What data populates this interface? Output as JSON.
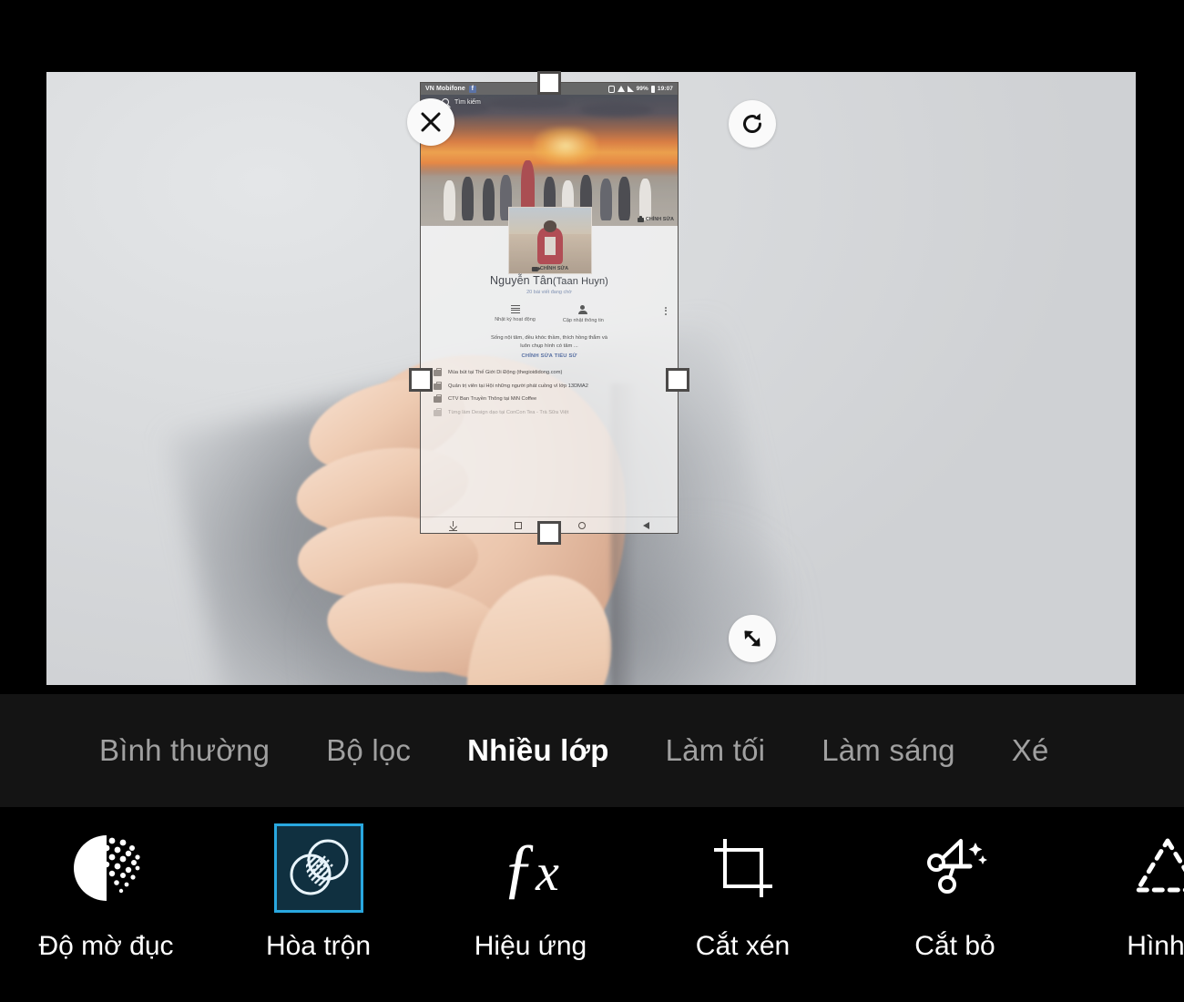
{
  "app": {
    "type": "photo-editor-mobile",
    "accent_selected": "#29a8e0",
    "tab_bar_bg": "#141414",
    "toolbar_bg": "#000000"
  },
  "canvas": {
    "background_photo_description": "hand holding phone against light gray wall with shadow",
    "controls": {
      "close": "close-icon",
      "rotate": "rotate-icon",
      "resize": "resize-diagonal-icon"
    }
  },
  "overlay_screenshot": {
    "status_bar": {
      "carrier": "VN Mobifone",
      "app_badge": "f",
      "battery": "99%",
      "time": "19:07"
    },
    "search": {
      "placeholder": "Tìm kiếm"
    },
    "cover": {
      "edit_label": "CHỈNH SỬA"
    },
    "avatar": {
      "edit_label": "CHỈNH SỬA"
    },
    "profile": {
      "name": "Nguyễn Tân",
      "nickname": "(Taan Huyn)",
      "subtitle": "20 bài viết đang chờ"
    },
    "actions": [
      {
        "icon": "activity-log-icon",
        "label": "Nhật ký hoạt động"
      },
      {
        "icon": "update-info-icon",
        "label": "Cập nhật thông tin"
      }
    ],
    "bio": {
      "line1": "Sống nội tâm, đều khóc thầm, thích hồng thắm và",
      "line2": "luôn chụp hình có tâm ...",
      "edit_label": "CHỈNH SỬA TIỂU SỬ"
    },
    "info_rows": [
      {
        "icon": "briefcase-icon",
        "text": "Múa bút tại Thế Giới Di Động (thegioididong.com)"
      },
      {
        "icon": "briefcase-icon",
        "text": "Quản trị viên tại Hội những người phát cuồng vì lớp 13DMA2"
      },
      {
        "icon": "briefcase-icon",
        "text": "CTV Ban Truyền Thông tại MiN Coffee"
      },
      {
        "icon": "briefcase-icon",
        "text": "Từng làm Design dạo tại ConCon Tea - Trà Sữa Việt"
      }
    ],
    "nav_bar": [
      "download-icon",
      "square-icon",
      "circle-icon",
      "back-triangle-icon"
    ]
  },
  "tabs": [
    {
      "label": "Bình thường",
      "active": false
    },
    {
      "label": "Bộ lọc",
      "active": false
    },
    {
      "label": "Nhiều lớp",
      "active": true
    },
    {
      "label": "Làm tối",
      "active": false
    },
    {
      "label": "Làm sáng",
      "active": false
    },
    {
      "label": "Xé",
      "active": false
    }
  ],
  "tools": [
    {
      "icon": "opacity-dots-icon",
      "label": "Độ mờ đục",
      "selected": false
    },
    {
      "icon": "blend-circles-icon",
      "label": "Hòa trộn",
      "selected": true
    },
    {
      "icon": "fx-icon",
      "label": "Hiệu ứng",
      "selected": false
    },
    {
      "icon": "crop-icon",
      "label": "Cắt xén",
      "selected": false
    },
    {
      "icon": "scissors-icon",
      "label": "Cắt bỏ",
      "selected": false
    },
    {
      "icon": "dashed-triangle-icon",
      "label": "Hình d",
      "selected": false
    }
  ]
}
